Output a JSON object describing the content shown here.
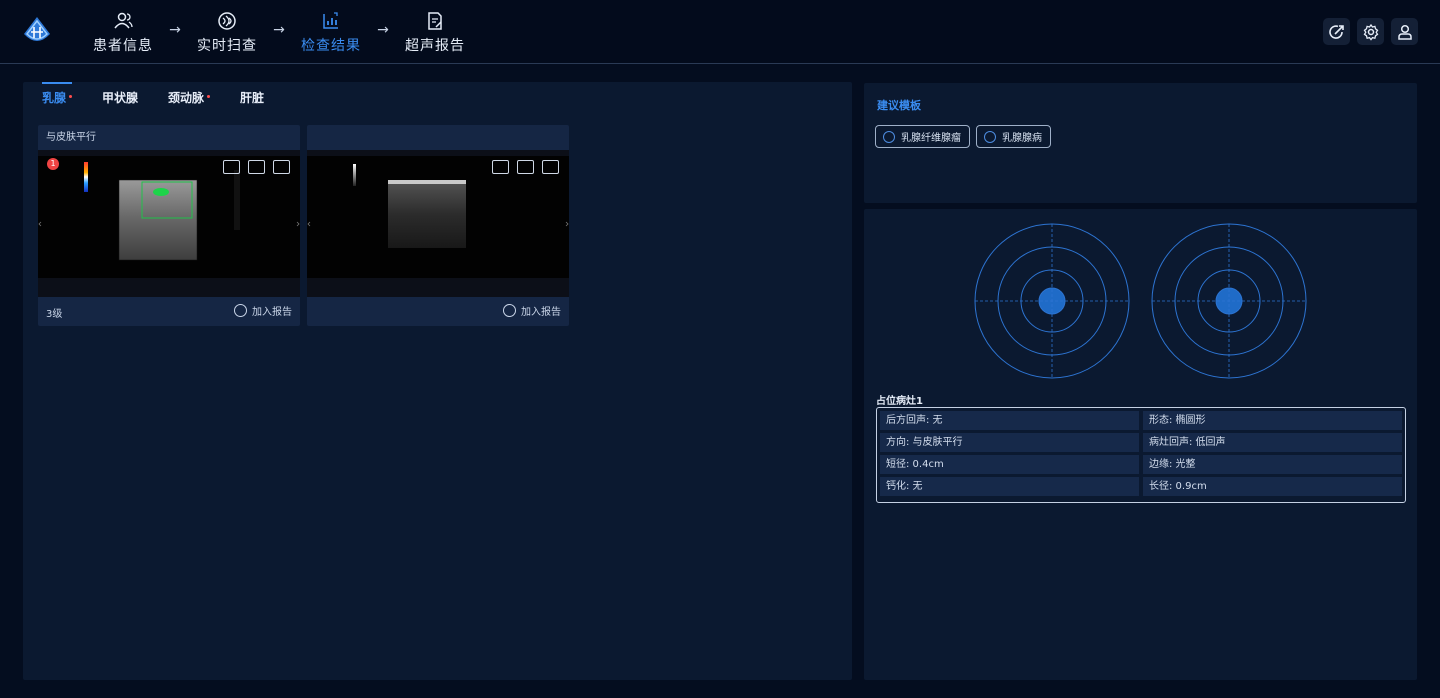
{
  "header": {
    "steps": [
      {
        "label": "患者信息",
        "icon": "users-icon",
        "active": false
      },
      {
        "label": "实时扫查",
        "icon": "scan-icon",
        "active": false
      },
      {
        "label": "检查结果",
        "icon": "chart-icon",
        "active": true
      },
      {
        "label": "超声报告",
        "icon": "report-icon",
        "active": false
      }
    ],
    "arrow": "→",
    "buttons": [
      "share-icon",
      "gear-icon",
      "user-icon"
    ],
    "accent": "#3a8cf0"
  },
  "tabs": [
    {
      "label": "乳腺",
      "active": true,
      "dot": true
    },
    {
      "label": "甲状腺",
      "active": false,
      "dot": false
    },
    {
      "label": "颈动脉",
      "active": false,
      "dot": true
    },
    {
      "label": "肝脏",
      "active": false,
      "dot": false
    }
  ],
  "cards": [
    {
      "title": "与皮肤平行",
      "grade": "3级",
      "add_label": "加入报告",
      "badge": "1"
    },
    {
      "title": "",
      "grade": "",
      "add_label": "加入报告",
      "badge": ""
    }
  ],
  "template_panel": {
    "title": "建议模板",
    "options": [
      "乳腺纤维腺瘤",
      "乳腺腺病"
    ]
  },
  "lesion": {
    "title": "占位病灶1",
    "rows": [
      [
        "后方回声: 无",
        "形态: 椭圆形"
      ],
      [
        "方向: 与皮肤平行",
        "病灶回声: 低回声"
      ],
      [
        "短径: 0.4cm",
        "边缘: 光整"
      ],
      [
        "钙化: 无",
        "长径: 0.9cm"
      ]
    ]
  },
  "colors": {
    "accent": "#3a8cf0",
    "dot": "#ff4d4d",
    "target_fill": "#1f6bc7"
  }
}
